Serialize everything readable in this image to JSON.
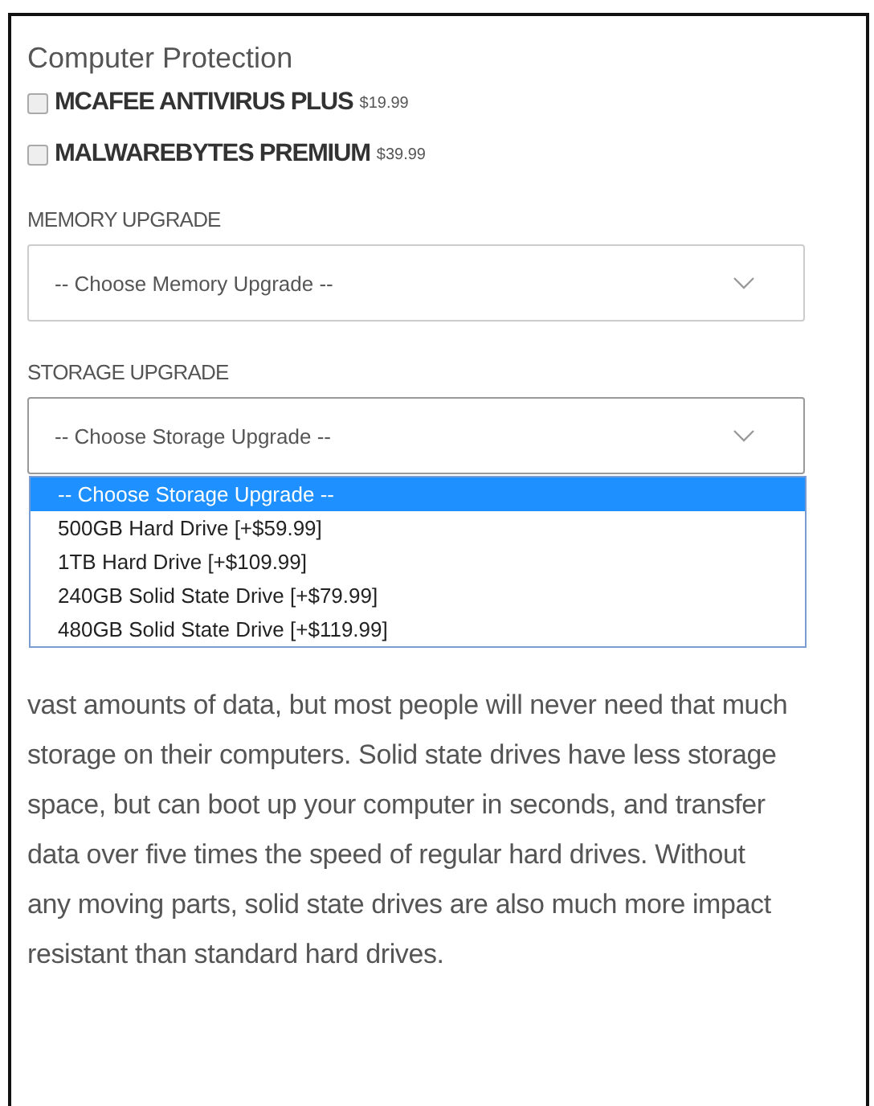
{
  "section_title": "Computer Protection",
  "protection_options": [
    {
      "name": "MCAFEE ANTIVIRUS PLUS",
      "price": "$19.99",
      "checked": false
    },
    {
      "name": "MALWAREBYTES PREMIUM",
      "price": "$39.99",
      "checked": false
    }
  ],
  "memory_upgrade": {
    "label": "MEMORY UPGRADE",
    "value": "-- Choose Memory Upgrade --"
  },
  "storage_upgrade": {
    "label": "STORAGE UPGRADE",
    "value": "-- Choose Storage Upgrade --",
    "expanded": true,
    "options": [
      {
        "label": "-- Choose Storage Upgrade --",
        "selected": true
      },
      {
        "label": "500GB Hard Drive [+$59.99]",
        "selected": false
      },
      {
        "label": "1TB Hard Drive [+$109.99]",
        "selected": false
      },
      {
        "label": "240GB Solid State Drive [+$79.99]",
        "selected": false
      },
      {
        "label": "480GB Solid State Drive [+$119.99]",
        "selected": false
      }
    ]
  },
  "description": "vast amounts of data, but most people will never need that much storage on their computers. Solid state drives have less storage space, but can boot up your computer in seconds, and transfer data over five times the speed of regular hard drives. Without any moving parts, solid state drives are also much more impact resistant than standard hard drives."
}
